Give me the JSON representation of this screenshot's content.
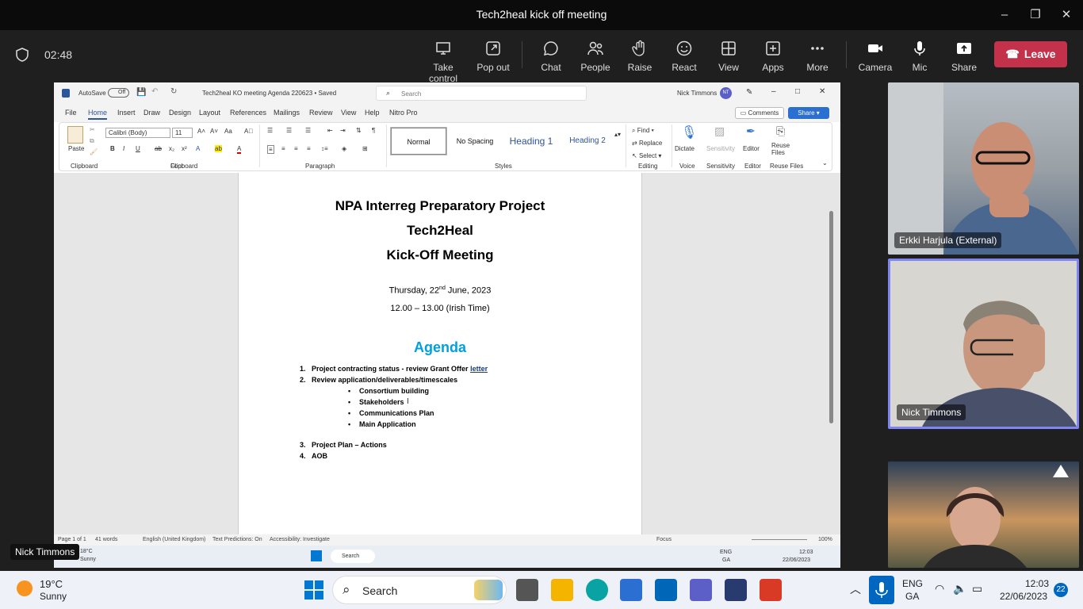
{
  "meeting": {
    "title": "Tech2heal kick off meeting",
    "timer": "02:48",
    "toolbar": [
      {
        "label": "Take control",
        "icon": "take-control-icon"
      },
      {
        "label": "Pop out",
        "icon": "pop-out-icon"
      },
      {
        "label": "Chat",
        "icon": "chat-icon"
      },
      {
        "label": "People",
        "icon": "people-icon"
      },
      {
        "label": "Raise",
        "icon": "raise-hand-icon"
      },
      {
        "label": "React",
        "icon": "react-icon"
      },
      {
        "label": "View",
        "icon": "view-icon"
      },
      {
        "label": "Apps",
        "icon": "apps-icon"
      },
      {
        "label": "More",
        "icon": "more-icon"
      },
      {
        "label": "Camera",
        "icon": "camera-icon"
      },
      {
        "label": "Mic",
        "icon": "mic-icon"
      },
      {
        "label": "Share",
        "icon": "share-icon"
      }
    ],
    "leave_label": "Leave",
    "presenter_tag": "Nick Timmons",
    "participants": [
      {
        "name": "Erkki Harjula (External)"
      },
      {
        "name": "Nick Timmons"
      },
      {
        "name": ""
      }
    ]
  },
  "word": {
    "autosave": "AutoSave",
    "autosave_state": "Off",
    "doc_name": "Tech2heal KO meeting Agenda 220623 • Saved",
    "search_placeholder": "Search",
    "user": "Nick Timmons",
    "user_initials": "NT",
    "tabs": [
      "File",
      "Home",
      "Insert",
      "Draw",
      "Design",
      "Layout",
      "References",
      "Mailings",
      "Review",
      "View",
      "Help",
      "Nitro Pro"
    ],
    "active_tab": "Home",
    "comments_label": "Comments",
    "share_label": "Share",
    "font_name": "Calibri (Body)",
    "font_size": "11",
    "styles": [
      "Normal",
      "No Spacing",
      "Heading 1",
      "Heading 2"
    ],
    "groups": [
      "Clipboard",
      "Font",
      "Paragraph",
      "Styles",
      "Editing",
      "Voice",
      "Sensitivity",
      "Editor",
      "Reuse Files"
    ],
    "paste_label": "Paste",
    "editing": [
      "Find",
      "Replace",
      "Select"
    ],
    "dictate_label": "Dictate",
    "sensitivity_label": "Sensitivity",
    "editor_label": "Editor",
    "reuse_label": "Reuse Files",
    "status": {
      "page": "Page 1 of 1",
      "words": "41 words",
      "language": "English (United Kingdom)",
      "predictions": "Text Predictions: On",
      "accessibility": "Accessibility: Investigate",
      "focus": "Focus",
      "zoom": "100%"
    }
  },
  "document": {
    "title1": "NPA Interreg Preparatory Project",
    "title2": "Tech2Heal",
    "title3": "Kick-Off Meeting",
    "date_pre": "Thursday, 22",
    "date_sup": "nd",
    "date_post": " June, 2023",
    "time": "12.00 – 13.00 (Irish Time)",
    "agenda_heading": "Agenda",
    "items": [
      {
        "num": "1.",
        "text": "Project contracting status - review Grant Offer ",
        "link": "letter"
      },
      {
        "num": "2.",
        "text": "Review application/deliverables/timescales"
      }
    ],
    "subitems": [
      "Consortium building",
      "Stakeholders",
      "Communications Plan",
      "Main Application"
    ],
    "items2": [
      {
        "num": "3.",
        "text": "Project Plan – Actions"
      },
      {
        "num": "4.",
        "text": "AOB"
      }
    ]
  },
  "inner_taskbar": {
    "temp": "18°C",
    "weather": "Sunny",
    "search": "Search",
    "lang1": "ENG",
    "lang2": "GA",
    "time": "12:03",
    "date": "22/06/2023"
  },
  "taskbar": {
    "temp": "19°C",
    "weather": "Sunny",
    "search": "Search",
    "lang1": "ENG",
    "lang2": "GA",
    "time": "12:03",
    "date": "22/06/2023",
    "badge": "22"
  }
}
